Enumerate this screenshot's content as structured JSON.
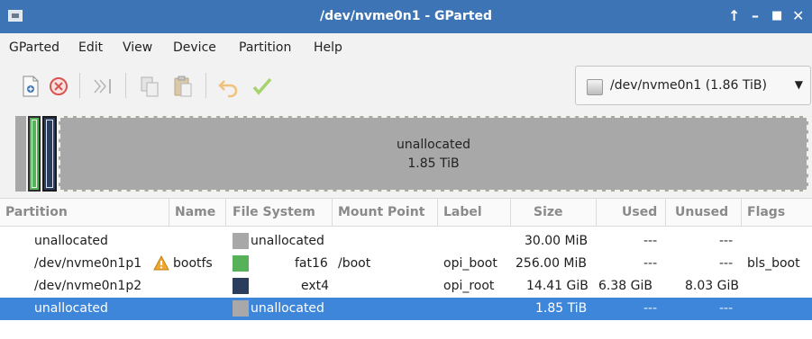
{
  "window": {
    "title": "/dev/nvme0n1 - GParted",
    "controls": [
      "up-arrow-icon",
      "minimize-icon",
      "maximize-icon",
      "close-icon"
    ]
  },
  "menu": [
    "GParted",
    "Edit",
    "View",
    "Device",
    "Partition",
    "Help"
  ],
  "toolbar": {
    "buttons": [
      "new-partition-icon",
      "delete-partition-icon",
      "resize-move-icon",
      "copy-icon",
      "paste-icon",
      "undo-icon",
      "apply-icon"
    ],
    "device": "/dev/nvme0n1 (1.86 TiB)"
  },
  "map": {
    "large_label": "unallocated",
    "large_size": "1.85 TiB"
  },
  "columns": [
    "Partition",
    "Name",
    "File System",
    "Mount Point",
    "Label",
    "Size",
    "Used",
    "Unused",
    "Flags"
  ],
  "rows": [
    {
      "partition": "unallocated",
      "name": "",
      "fs": "unallocated",
      "mount": "",
      "label": "",
      "size": "30.00 MiB",
      "used": "---",
      "unused": "---",
      "flags": "",
      "color": "#a8a8a8"
    },
    {
      "partition": "/dev/nvme0n1p1",
      "name": "bootfs",
      "fs": "fat16",
      "mount": "/boot",
      "label": "opi_boot",
      "size": "256.00 MiB",
      "used": "---",
      "unused": "---",
      "flags": "bls_boot",
      "color": "#57b158",
      "warning": true
    },
    {
      "partition": "/dev/nvme0n1p2",
      "name": "",
      "fs": "ext4",
      "mount": "",
      "label": "opi_root",
      "size": "14.41 GiB",
      "used": "6.38 GiB",
      "unused": "8.03 GiB",
      "flags": "",
      "color": "#2b3d5c"
    },
    {
      "partition": "unallocated",
      "name": "",
      "fs": "unallocated",
      "mount": "",
      "label": "",
      "size": "1.85 TiB",
      "used": "---",
      "unused": "---",
      "flags": "",
      "color": "#a8a8a8",
      "selected": true
    }
  ],
  "colors": {
    "titlebar": "#3d74b5",
    "selection": "#3d86d9",
    "unallocated": "#a8a8a8",
    "fat16": "#57b158",
    "ext4": "#2b3d5c"
  }
}
